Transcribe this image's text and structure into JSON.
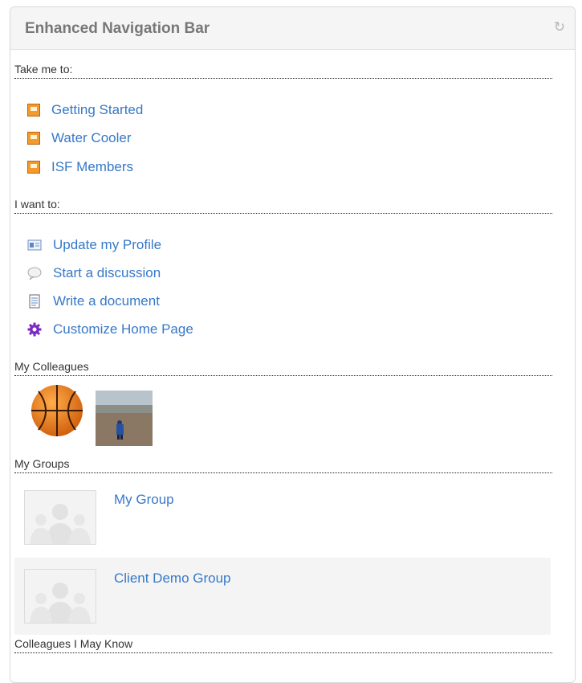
{
  "widget": {
    "title": "Enhanced Navigation Bar"
  },
  "take_me_to": {
    "heading": "Take me to:",
    "items": [
      "Getting Started",
      "Water Cooler",
      "ISF Members"
    ]
  },
  "i_want_to": {
    "heading": "I want to:",
    "items": [
      "Update my Profile",
      "Start a discussion",
      "Write a document",
      "Customize Home Page"
    ]
  },
  "colleagues": {
    "heading": "My Colleagues"
  },
  "groups": {
    "heading": "My Groups",
    "items": [
      "My Group",
      "Client Demo Group"
    ]
  },
  "may_know": {
    "heading": "Colleagues I May Know"
  },
  "colors": {
    "link": "#3778c7",
    "place_icon": "#f39a2b",
    "gear_icon": "#7b2bbf"
  },
  "icons": [
    "refresh-icon",
    "place-icon",
    "profile-card-icon",
    "speech-bubble-icon",
    "document-icon",
    "gear-icon"
  ]
}
